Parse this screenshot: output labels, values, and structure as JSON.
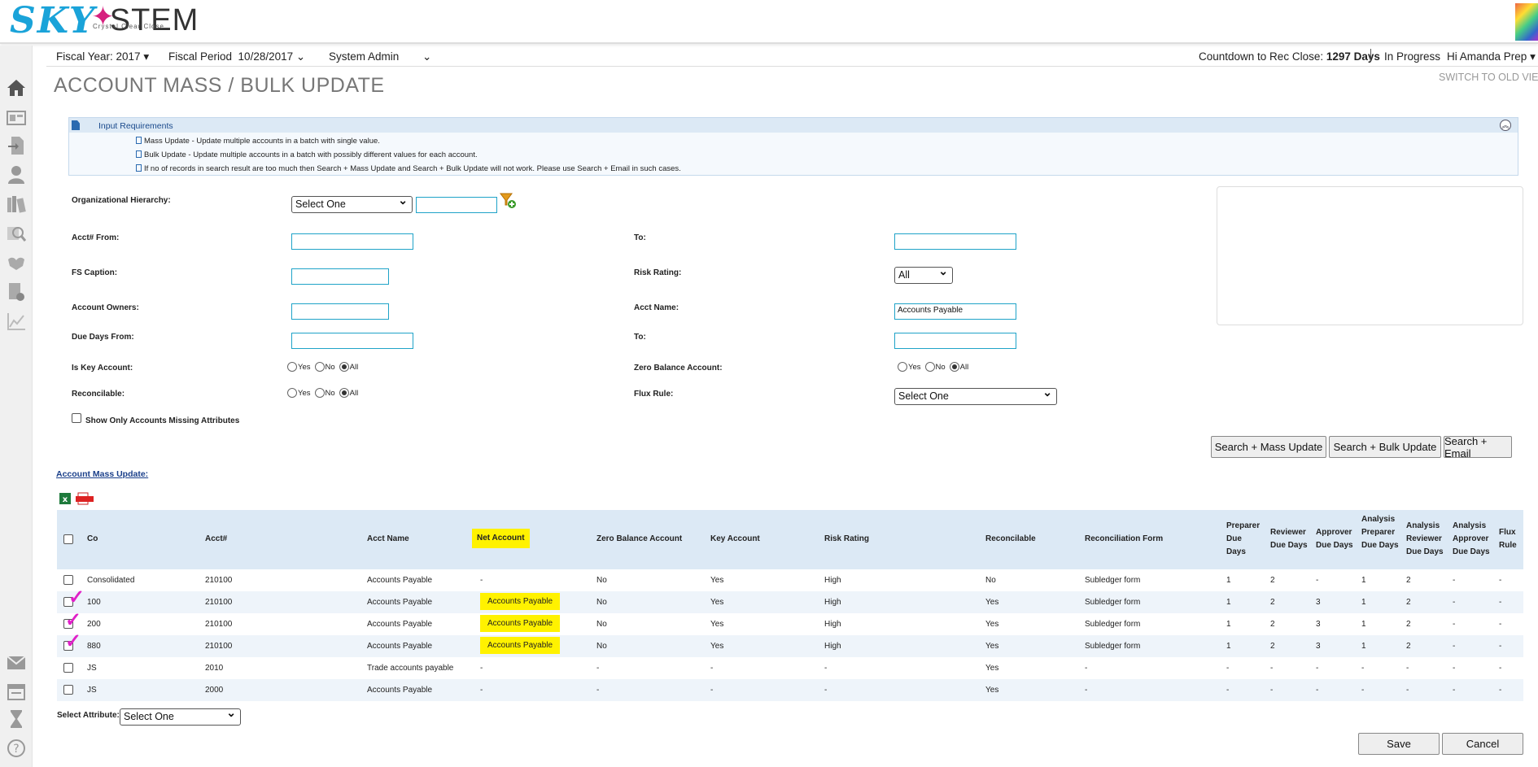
{
  "brand": {
    "logo_left": "SKY",
    "logo_right": "STEM",
    "tagline": "Crystal Clear Close"
  },
  "subbar": {
    "fiscal_year": "Fiscal Year: 2017",
    "fiscal_period_label": "Fiscal Period",
    "fiscal_period_value": "10/28/2017",
    "role": "System Admin",
    "countdown_label": "Countdown to Rec Close:",
    "countdown_value": "1297 Days",
    "status": "In Progress",
    "greeting": "Hi Amanda Prep"
  },
  "page": {
    "title": "ACCOUNT MASS / BULK UPDATE",
    "switch_link": "SWITCH TO OLD VIE"
  },
  "requirements": {
    "title": "Input Requirements",
    "lines": [
      "Mass Update - Update multiple accounts in a batch with single value.",
      "Bulk Update - Update multiple accounts in a batch with possibly different values for each account.",
      "If no of records in search result are too much then Search + Mass Update and Search + Bulk Update will not work. Please use Search + Email in such cases."
    ]
  },
  "form": {
    "org_label": "Organizational Hierarchy:",
    "org_select": "Select One",
    "acct_from_label": "Acct# From:",
    "to_label": "To:",
    "fs_caption_label": "FS Caption:",
    "risk_label": "Risk Rating:",
    "risk_value": "All",
    "owners_label": "Account Owners:",
    "acct_name_label": "Acct Name:",
    "acct_name_value": "Accounts Payable",
    "due_from_label": "Due Days From:",
    "is_key_label": "Is Key Account:",
    "zero_bal_label": "Zero Balance Account:",
    "reconcilable_label": "Reconcilable:",
    "flux_label": "Flux Rule:",
    "flux_value": "Select One",
    "yes": "Yes",
    "no": "No",
    "all": "All",
    "missing_attr": "Show Only Accounts Missing Attributes"
  },
  "buttons": {
    "mass": "Search + Mass Update",
    "bulk": "Search + Bulk Update",
    "email": "Search + Email",
    "save": "Save",
    "cancel": "Cancel"
  },
  "section_link": "Account Mass Update:",
  "table": {
    "headers": {
      "co": "Co",
      "acct": "Acct#",
      "acct_name": "Acct Name",
      "net": "Net Account",
      "zero": "Zero Balance Account",
      "key": "Key Account",
      "risk": "Risk Rating",
      "recon": "Reconcilable",
      "form": "Reconciliation Form",
      "prep": "Preparer Due Days",
      "rev": "Reviewer Due Days",
      "appr": "Approver Due Days",
      "aprep": "Analysis Preparer Due Days",
      "arev": "Analysis Reviewer Due Days",
      "aappr": "Analysis Approver Due Days",
      "flux": "Flux Rule"
    },
    "rows": [
      {
        "co": "Consolidated",
        "acct": "210100",
        "name": "Accounts Payable",
        "net": "-",
        "zero": "No",
        "key": "Yes",
        "risk": "High",
        "recon": "No",
        "form": "Subledger form",
        "prep": "1",
        "rev": "2",
        "appr": "-",
        "aprep": "1",
        "arev": "2",
        "aappr": "-",
        "flux": "-"
      },
      {
        "co": "100",
        "acct": "210100",
        "name": "Accounts Payable",
        "net": "Accounts Payable",
        "zero": "No",
        "key": "Yes",
        "risk": "High",
        "recon": "Yes",
        "form": "Subledger form",
        "prep": "1",
        "rev": "2",
        "appr": "3",
        "aprep": "1",
        "arev": "2",
        "aappr": "-",
        "flux": "-"
      },
      {
        "co": "200",
        "acct": "210100",
        "name": "Accounts Payable",
        "net": "Accounts Payable",
        "zero": "No",
        "key": "Yes",
        "risk": "High",
        "recon": "Yes",
        "form": "Subledger form",
        "prep": "1",
        "rev": "2",
        "appr": "3",
        "aprep": "1",
        "arev": "2",
        "aappr": "-",
        "flux": "-"
      },
      {
        "co": "880",
        "acct": "210100",
        "name": "Accounts Payable",
        "net": "Accounts Payable",
        "zero": "No",
        "key": "Yes",
        "risk": "High",
        "recon": "Yes",
        "form": "Subledger form",
        "prep": "1",
        "rev": "2",
        "appr": "3",
        "aprep": "1",
        "arev": "2",
        "aappr": "-",
        "flux": "-"
      },
      {
        "co": "JS",
        "acct": "2010",
        "name": "Trade accounts payable",
        "net": "-",
        "zero": "-",
        "key": "-",
        "risk": "-",
        "recon": "Yes",
        "form": "-",
        "prep": "-",
        "rev": "-",
        "appr": "-",
        "aprep": "-",
        "arev": "-",
        "aappr": "-",
        "flux": "-"
      },
      {
        "co": "JS",
        "acct": "2000",
        "name": "Accounts Payable",
        "net": "-",
        "zero": "-",
        "key": "-",
        "risk": "-",
        "recon": "Yes",
        "form": "-",
        "prep": "-",
        "rev": "-",
        "appr": "-",
        "aprep": "-",
        "arev": "-",
        "aappr": "-",
        "flux": "-"
      }
    ]
  },
  "select_attribute": {
    "label": "Select Attribute:",
    "value": "Select One"
  }
}
